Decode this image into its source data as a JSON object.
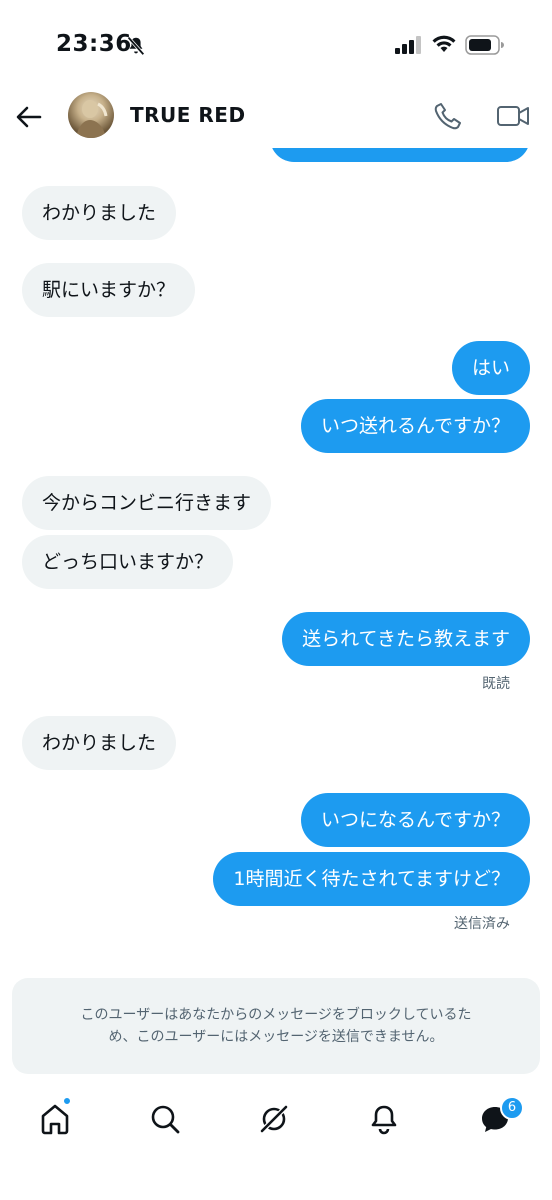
{
  "status_bar": {
    "time": "23:36"
  },
  "header": {
    "title": "TRUE RED"
  },
  "messages": [
    {
      "text": "わかりました"
    },
    {
      "text": "駅にいますか？"
    },
    {
      "text": "はい"
    },
    {
      "text": "いつ送れるんですか？"
    },
    {
      "text": "今からコンビニ行きます"
    },
    {
      "text": "どっち口いますか？"
    },
    {
      "text": "送られてきたら教えます"
    },
    {
      "text": "わかりました"
    },
    {
      "text": "いつになるんですか？"
    },
    {
      "text": "1時間近く待たされてますけど？"
    }
  ],
  "meta": {
    "read": "既読",
    "sent": "送信済み"
  },
  "blocked_notice": {
    "line1": "このユーザーはあなたからのメッセージをブロックしているた",
    "line2": "め、このユーザーにはメッセージを送信できません。"
  },
  "nav": {
    "messages_badge": "6"
  },
  "colors": {
    "accent": "#1d9bf0",
    "incoming_bubble": "#eff3f4",
    "text": "#0f1419",
    "muted": "#536471"
  }
}
